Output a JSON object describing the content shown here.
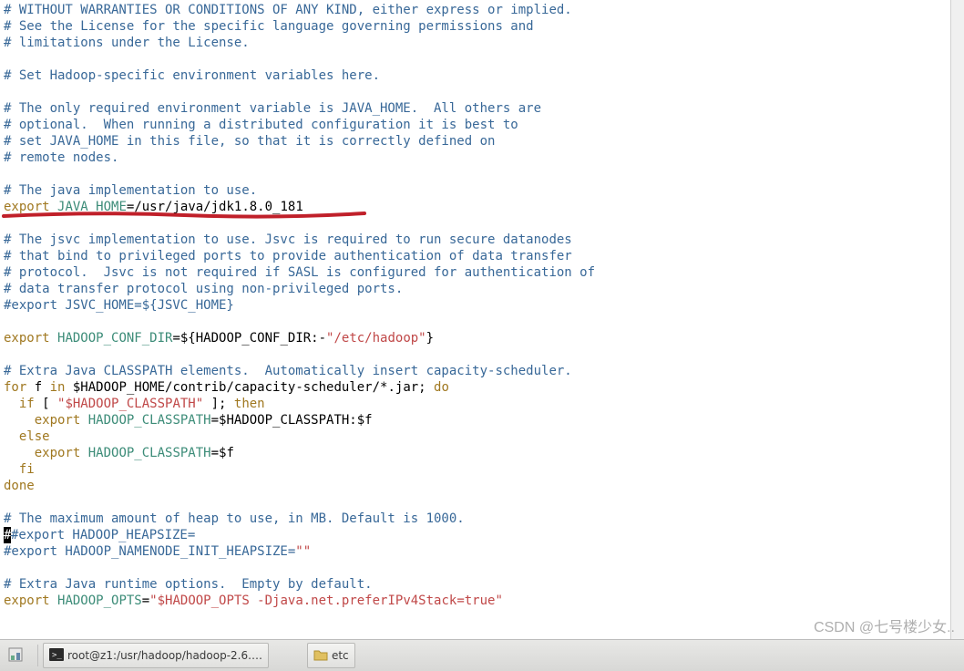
{
  "code": {
    "l1": "# WITHOUT WARRANTIES OR CONDITIONS OF ANY KIND, either express or implied.",
    "l2": "# See the License for the specific language governing permissions and",
    "l3": "# limitations under the License.",
    "l4": "",
    "l5": "# Set Hadoop-specific environment variables here.",
    "l6": "",
    "l7": "# The only required environment variable is JAVA_HOME.  All others are",
    "l8": "# optional.  When running a distributed configuration it is best to",
    "l9": "# set JAVA_HOME in this file, so that it is correctly defined on",
    "l10": "# remote nodes.",
    "l11": "",
    "l12": "# The java implementation to use.",
    "l13_kw": "export",
    "l13_var": "JAVA_HOME",
    "l13_eq": "=",
    "l13_path": "/usr/java/jdk1.8.0_181",
    "l14": "",
    "l15": "# The jsvc implementation to use. Jsvc is required to run secure datanodes",
    "l16": "# that bind to privileged ports to provide authentication of data transfer",
    "l17": "# protocol.  Jsvc is not required if SASL is configured for authentication of",
    "l18": "# data transfer protocol using non-privileged ports.",
    "l19": "#export JSVC_HOME=${JSVC_HOME}",
    "l20": "",
    "l21_kw": "export",
    "l21_var": "HADOOP_CONF_DIR",
    "l21_mid1": "=${HADOOP_CONF_DIR:-",
    "l21_str": "\"/etc/hadoop\"",
    "l21_end": "}",
    "l22": "",
    "l23": "# Extra Java CLASSPATH elements.  Automatically insert capacity-scheduler.",
    "l24_for": "for",
    "l24_f": " f ",
    "l24_in": "in",
    "l24_mid": " $HADOOP_HOME/contrib/capacity-scheduler/*.jar; ",
    "l24_do": "do",
    "l25_pre": "  ",
    "l25_if": "if",
    "l25_mid": " [ ",
    "l25_str": "\"$HADOOP_CLASSPATH\"",
    "l25_mid2": " ]; ",
    "l25_then": "then",
    "l26_pre": "    ",
    "l26_kw": "export",
    "l26_sp": " ",
    "l26_var": "HADOOP_CLASSPATH",
    "l26_rest": "=$HADOOP_CLASSPATH:$f",
    "l27_pre": "  ",
    "l27_else": "else",
    "l28_pre": "    ",
    "l28_kw": "export",
    "l28_sp": " ",
    "l28_var": "HADOOP_CLASSPATH",
    "l28_rest": "=$f",
    "l29_pre": "  ",
    "l29_fi": "fi",
    "l30_done": "done",
    "l31": "",
    "l32": "# The maximum amount of heap to use, in MB. Default is 1000.",
    "l33": "#export HADOOP_HEAPSIZE=",
    "l34_a": "#export HADOOP_NAMENODE_INIT_HEAPSIZE=",
    "l34_str": "\"\"",
    "l35": "",
    "l36": "# Extra Java runtime options.  Empty by default.",
    "l37_kw": "export",
    "l37_sp": " ",
    "l37_var": "HADOOP_OPTS",
    "l37_eq": "=",
    "l37_str": "\"$HADOOP_OPTS -Djava.net.preferIPv4Stack=true\""
  },
  "taskbar": {
    "term_title": "root@z1:/usr/hadoop/hadoop-2.6.…",
    "fm_title": "etc"
  },
  "watermark": "CSDN @七号楼少女.."
}
